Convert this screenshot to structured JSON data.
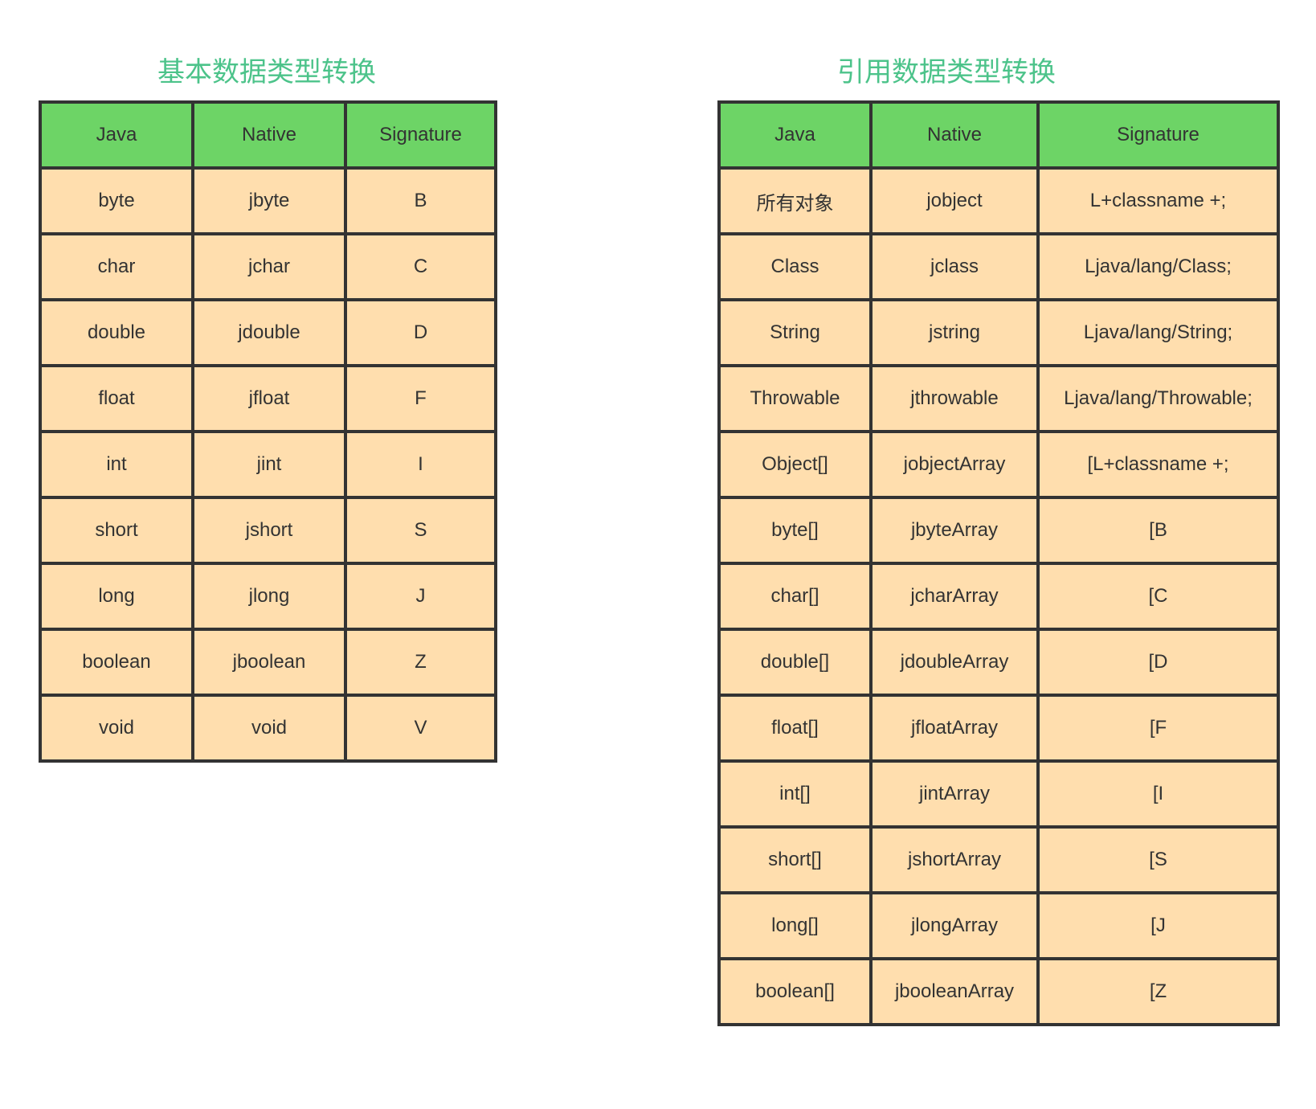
{
  "colors": {
    "title": "#4cc38a",
    "header_bg": "#6dd466",
    "cell_bg": "#ffdeae",
    "border": "#333333",
    "text": "#333333"
  },
  "primitive": {
    "title": "基本数据类型转换",
    "headers": [
      "Java",
      "Native",
      "Signature"
    ],
    "rows": [
      [
        "byte",
        "jbyte",
        "B"
      ],
      [
        "char",
        "jchar",
        "C"
      ],
      [
        "double",
        "jdouble",
        "D"
      ],
      [
        "float",
        "jfloat",
        "F"
      ],
      [
        "int",
        "jint",
        "I"
      ],
      [
        "short",
        "jshort",
        "S"
      ],
      [
        "long",
        "jlong",
        "J"
      ],
      [
        "boolean",
        "jboolean",
        "Z"
      ],
      [
        "void",
        "void",
        "V"
      ]
    ]
  },
  "reference": {
    "title": "引用数据类型转换",
    "headers": [
      "Java",
      "Native",
      "Signature"
    ],
    "rows": [
      [
        "所有对象",
        "jobject",
        "L+classname +;"
      ],
      [
        "Class",
        "jclass",
        "Ljava/lang/Class;"
      ],
      [
        "String",
        "jstring",
        "Ljava/lang/String;"
      ],
      [
        "Throwable",
        "jthrowable",
        "Ljava/lang/Throwable;"
      ],
      [
        "Object[]",
        "jobjectArray",
        "[L+classname +;"
      ],
      [
        "byte[]",
        "jbyteArray",
        "[B"
      ],
      [
        "char[]",
        "jcharArray",
        "[C"
      ],
      [
        "double[]",
        "jdoubleArray",
        "[D"
      ],
      [
        "float[]",
        "jfloatArray",
        "[F"
      ],
      [
        "int[]",
        "jintArray",
        "[I"
      ],
      [
        "short[]",
        "jshortArray",
        "[S"
      ],
      [
        "long[]",
        "jlongArray",
        "[J"
      ],
      [
        "boolean[]",
        "jbooleanArray",
        "[Z"
      ]
    ]
  }
}
